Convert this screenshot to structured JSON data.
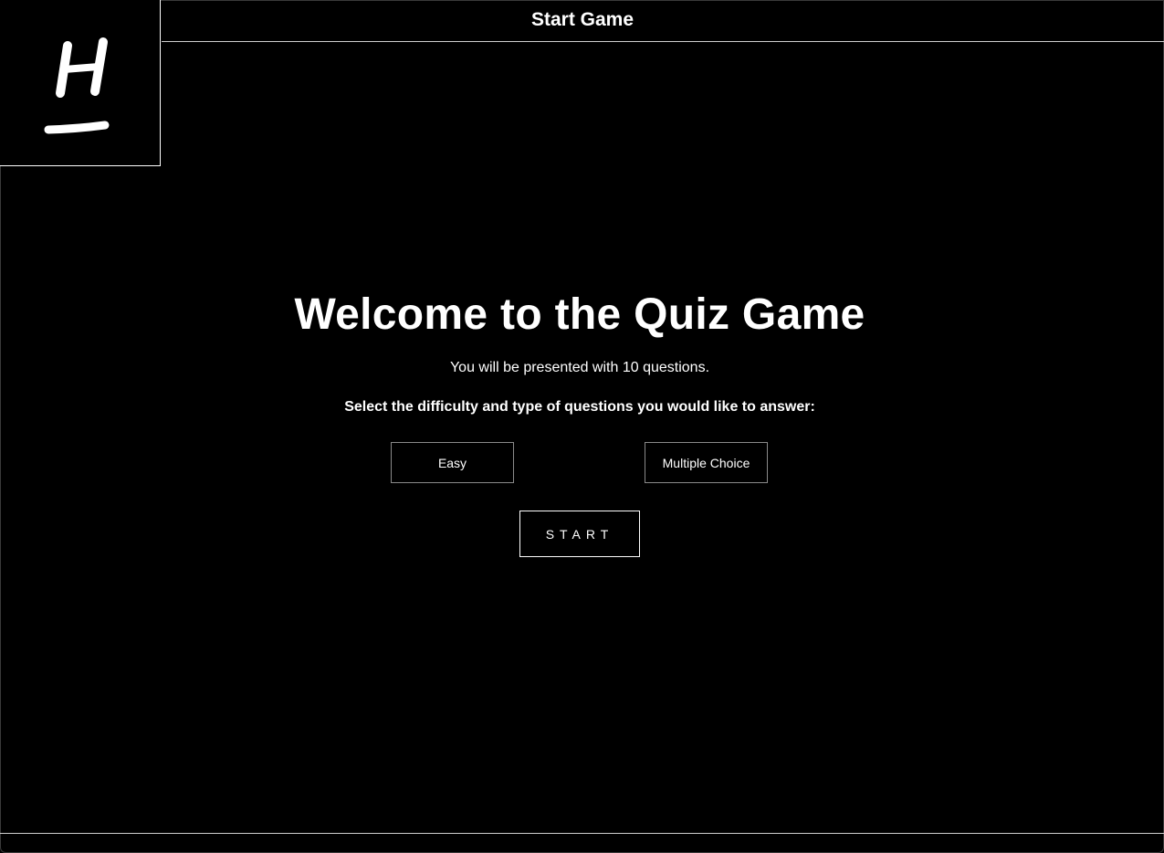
{
  "header": {
    "title": "Start Game"
  },
  "logo": {
    "letter": "H",
    "icon": "logo-h-underline"
  },
  "main": {
    "heading": "Welcome to the Quiz Game",
    "intro": "You will be presented with 10 questions.",
    "prompt": "Select the difficulty and type of questions you would like to answer:"
  },
  "controls": {
    "difficulty": "Easy",
    "type": "Multiple Choice",
    "start_label": "START"
  },
  "colors": {
    "background": "#000000",
    "foreground": "#ffffff",
    "border": "#cfcfcf"
  }
}
